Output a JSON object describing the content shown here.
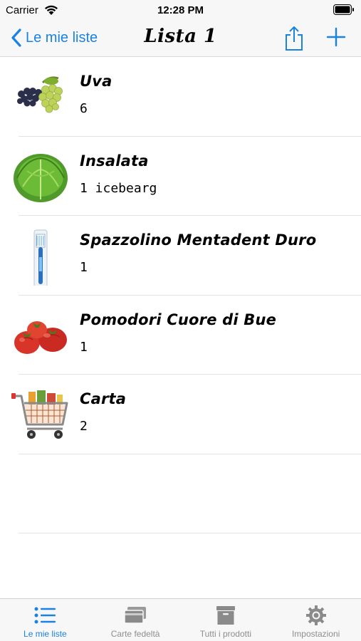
{
  "status_bar": {
    "carrier": "Carrier",
    "time": "12:28 PM"
  },
  "nav": {
    "back_label": "Le mie liste",
    "title": "Lista 1",
    "accent_color": "#1a82e2"
  },
  "items": [
    {
      "name": "Uva",
      "quantity": "6",
      "icon": "grapes-icon"
    },
    {
      "name": "Insalata",
      "quantity": "1 icebearg",
      "icon": "lettuce-icon"
    },
    {
      "name": "Spazzolino Mentadent Duro",
      "quantity": "1",
      "icon": "toothbrush-icon"
    },
    {
      "name": "Pomodori Cuore di Bue",
      "quantity": "1",
      "icon": "tomatoes-icon"
    },
    {
      "name": "Carta",
      "quantity": "2",
      "icon": "shopping-cart-icon"
    }
  ],
  "tabs": [
    {
      "label": "Le mie liste",
      "icon": "list-icon",
      "active": true
    },
    {
      "label": "Carte fedeltà",
      "icon": "cards-icon",
      "active": false
    },
    {
      "label": "Tutti i prodotti",
      "icon": "archive-box-icon",
      "active": false
    },
    {
      "label": "Impostazioni",
      "icon": "gear-icon",
      "active": false
    }
  ]
}
